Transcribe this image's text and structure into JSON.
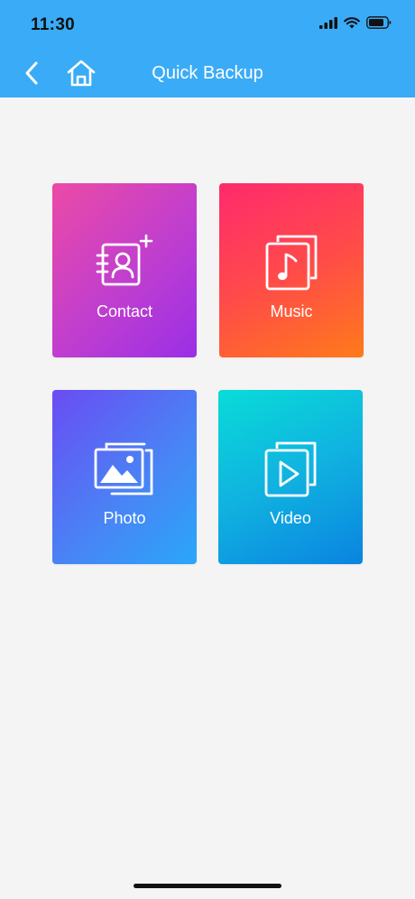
{
  "status_bar": {
    "time": "11:30",
    "icons": [
      "cellular-signal-icon",
      "wifi-icon",
      "battery-icon"
    ]
  },
  "nav": {
    "title": "Quick Backup",
    "back_icon": "chevron-left-icon",
    "home_icon": "home-icon"
  },
  "tiles": [
    {
      "label": "Contact",
      "icon": "contact-add-icon"
    },
    {
      "label": "Music",
      "icon": "music-file-icon"
    },
    {
      "label": "Photo",
      "icon": "photo-file-icon"
    },
    {
      "label": "Video",
      "icon": "video-file-icon"
    }
  ],
  "colors": {
    "header": "#3aabf7",
    "background": "#f4f4f4",
    "contact_gradient": [
      "#ec4aa6",
      "#9a2fe6"
    ],
    "music_gradient": [
      "#ff2a6d",
      "#ff7a1a"
    ],
    "photo_gradient": [
      "#6a4cf3",
      "#2aa7f9"
    ],
    "video_gradient": [
      "#09dcd8",
      "#0a84e0"
    ]
  }
}
